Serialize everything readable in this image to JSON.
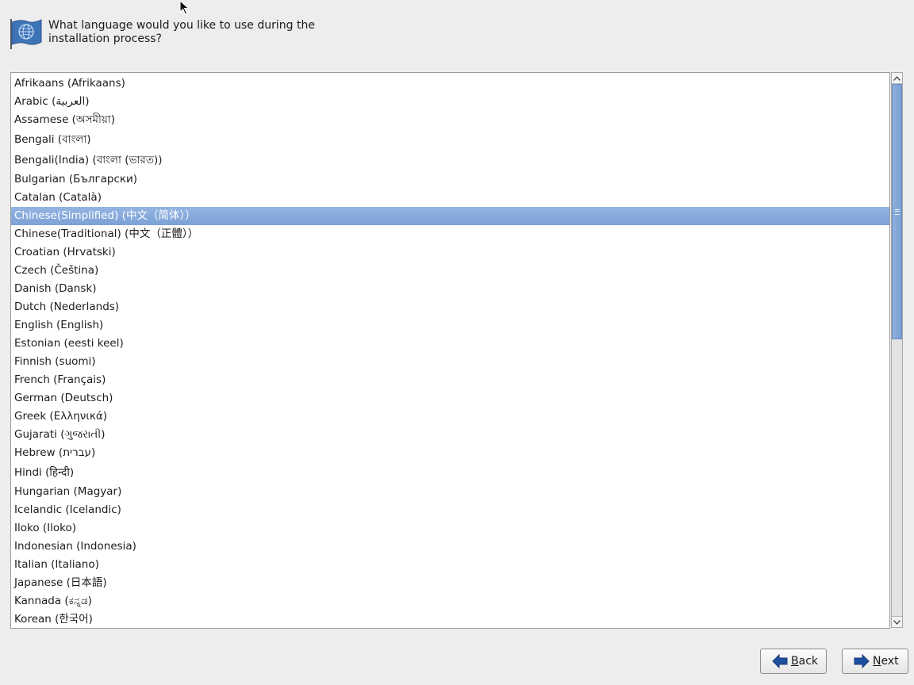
{
  "header": {
    "question": "What language would you like to use during the installation process?"
  },
  "languages": [
    "Afrikaans (Afrikaans)",
    "Arabic (العربية)",
    "Assamese (অসমীয়া)",
    "Bengali (বাংলা)",
    "Bengali(India) (বাংলা (ভারত))",
    "Bulgarian (Български)",
    "Catalan (Català)",
    "Chinese(Simplified) (中文（简体））",
    "Chinese(Traditional) (中文（正體））",
    "Croatian (Hrvatski)",
    "Czech (Čeština)",
    "Danish (Dansk)",
    "Dutch (Nederlands)",
    "English (English)",
    "Estonian (eesti keel)",
    "Finnish (suomi)",
    "French (Français)",
    "German (Deutsch)",
    "Greek (Ελληνικά)",
    "Gujarati (ગુજરાતી)",
    "Hebrew (עברית)",
    "Hindi (हिन्दी)",
    "Hungarian (Magyar)",
    "Icelandic (Icelandic)",
    "Iloko (Iloko)",
    "Indonesian (Indonesia)",
    "Italian (Italiano)",
    "Japanese (日本語)",
    "Kannada (ಕನ್ನಡ)",
    "Korean (한국어)"
  ],
  "selected_language": "Chinese(Simplified) (中文（简体））",
  "buttons": {
    "back": "Back",
    "next": "Next"
  },
  "colors": {
    "selection": "#86aadb",
    "arrow_icon": "#1f4fa0"
  },
  "icons": {
    "header": "flag-globe-icon",
    "back": "arrow-left-icon",
    "next": "arrow-right-icon"
  }
}
